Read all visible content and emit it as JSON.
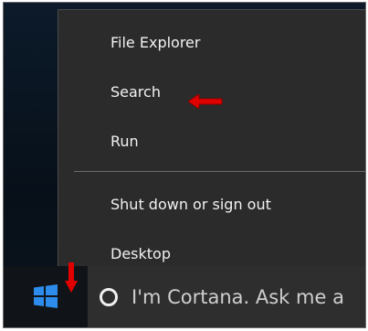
{
  "power_menu": {
    "items": [
      {
        "label": "File Explorer"
      },
      {
        "label": "Search"
      },
      {
        "label": "Run"
      },
      {
        "label": "Shut down or sign out"
      },
      {
        "label": "Desktop"
      }
    ]
  },
  "taskbar": {
    "start_icon": "windows-logo-icon",
    "search_placeholder": "I'm Cortana. Ask me a"
  },
  "colors": {
    "menu_bg": "#2b2b2b",
    "menu_text": "#f2f2f2",
    "taskbar_bg": "#101418",
    "search_bg": "#2e2e2e",
    "windows_blue": "#2d8ceb",
    "annotation_red": "#e00000"
  }
}
